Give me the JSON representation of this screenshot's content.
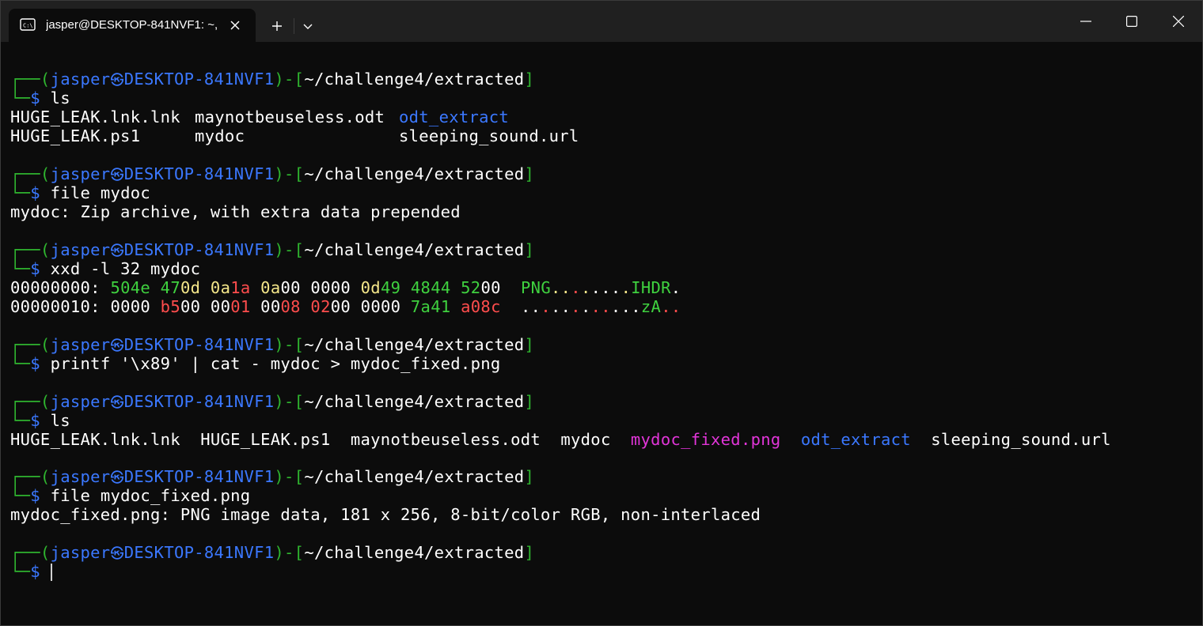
{
  "window": {
    "tab_title": "jasper@DESKTOP-841NVF1: ~,",
    "new_tab_icon": "plus-icon",
    "dropdown_icon": "chevron-down-icon",
    "minimize_icon": "minimize-icon",
    "maximize_icon": "maximize-icon",
    "close_icon": "close-icon"
  },
  "colors": {
    "background": "#0c0c0c",
    "titlebar": "#202020",
    "prompt_green": "#2fb52f",
    "prompt_blue": "#3b78ff",
    "directory_blue": "#3b78ff",
    "image_magenta": "#e235d9",
    "hex_red": "#ff4d4d",
    "hex_yellow": "#f5e78a"
  },
  "prompt": {
    "corner_top": "┌──(",
    "user": "jasper",
    "skull": "㉿",
    "host": "DESKTOP-841NVF1",
    "mid": ")-[",
    "path": "~/challenge4/extracted",
    "end": "]",
    "corner_bottom": "└─",
    "dollar": "$"
  },
  "blocks": [
    {
      "command": "ls",
      "output": [
        [
          "HUGE_LEAK.lnk.lnk",
          "maynotbeuseless.odt",
          "odt_extract"
        ],
        [
          "HUGE_LEAK.ps1",
          "mydoc",
          "sleeping_sound.url"
        ]
      ]
    },
    {
      "command": "file mydoc",
      "output_text": "mydoc: Zip archive, with extra data prepended"
    },
    {
      "command": "xxd -l 32 mydoc",
      "hex_rows": [
        {
          "offset": "00000000:",
          "groups": [
            [
              [
                "504e",
                "g"
              ]
            ],
            [
              [
                "47",
                "g"
              ],
              [
                "0d",
                "y"
              ]
            ],
            [
              [
                "0a",
                "y"
              ],
              [
                "1a",
                "r"
              ]
            ],
            [
              [
                "0a",
                "y"
              ],
              [
                "00",
                "w"
              ]
            ],
            [
              [
                "0000",
                "w"
              ]
            ],
            [
              [
                "0d",
                "y"
              ],
              [
                "49",
                "g"
              ]
            ],
            [
              [
                "4844",
                "g"
              ]
            ],
            [
              [
                "52",
                "g"
              ],
              [
                "00",
                "w"
              ]
            ]
          ],
          "ascii": [
            [
              "PNG",
              "g"
            ],
            [
              ".",
              "y"
            ],
            [
              ".",
              "y"
            ],
            [
              ".",
              "r"
            ],
            [
              ".",
              "y"
            ],
            [
              ".",
              "w"
            ],
            [
              ".",
              "w"
            ],
            [
              ".",
              "w"
            ],
            [
              ".",
              "y"
            ],
            [
              "IHDR",
              "g"
            ],
            [
              ".",
              "w"
            ]
          ]
        },
        {
          "offset": "00000010:",
          "groups": [
            [
              [
                "0000",
                "w"
              ]
            ],
            [
              [
                "b5",
                "r"
              ],
              [
                "00",
                "w"
              ]
            ],
            [
              [
                "00",
                "w"
              ],
              [
                "01",
                "r"
              ]
            ],
            [
              [
                "00",
                "w"
              ],
              [
                "08",
                "r"
              ]
            ],
            [
              [
                "02",
                "r"
              ],
              [
                "00",
                "w"
              ]
            ],
            [
              [
                "0000",
                "w"
              ]
            ],
            [
              [
                "7a41",
                "g"
              ]
            ],
            [
              [
                "a08c",
                "r"
              ]
            ]
          ],
          "ascii": [
            [
              ".",
              "w"
            ],
            [
              ".",
              "w"
            ],
            [
              ".",
              "r"
            ],
            [
              ".",
              "w"
            ],
            [
              ".",
              "w"
            ],
            [
              ".",
              "r"
            ],
            [
              ".",
              "w"
            ],
            [
              ".",
              "r"
            ],
            [
              ".",
              "r"
            ],
            [
              ".",
              "w"
            ],
            [
              ".",
              "w"
            ],
            [
              ".",
              "w"
            ],
            [
              "zA",
              "g"
            ],
            [
              ".",
              "r"
            ],
            [
              ".",
              "r"
            ]
          ]
        }
      ]
    },
    {
      "command": "printf '\\x89' | cat - mydoc > mydoc_fixed.png"
    },
    {
      "command": "ls",
      "output_row": [
        [
          "HUGE_LEAK.lnk.lnk",
          "w"
        ],
        [
          "HUGE_LEAK.ps1",
          "w"
        ],
        [
          "maynotbeuseless.odt",
          "w"
        ],
        [
          "mydoc",
          "w"
        ],
        [
          "mydoc_fixed.png",
          "m"
        ],
        [
          "odt_extract",
          "dir"
        ],
        [
          "sleeping_sound.url",
          "w"
        ]
      ]
    },
    {
      "command": "file mydoc_fixed.png",
      "output_text": "mydoc_fixed.png: PNG image data, 181 x 256, 8-bit/color RGB, non-interlaced"
    },
    {
      "command": ""
    }
  ]
}
